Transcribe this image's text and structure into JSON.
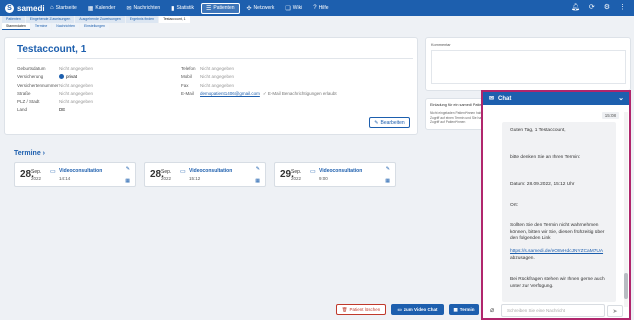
{
  "brand": {
    "name": "samedi"
  },
  "nav": [
    {
      "icon": "⌂",
      "label": "Startseite",
      "active": false
    },
    {
      "icon": "▦",
      "label": "Kalender",
      "active": false
    },
    {
      "icon": "✉",
      "label": "Nachrichten",
      "active": false
    },
    {
      "icon": "▮",
      "label": "Statistik",
      "active": false
    },
    {
      "icon": "☰",
      "label": "Patienten",
      "active": true
    },
    {
      "icon": "✣",
      "label": "Netzwerk",
      "active": false
    },
    {
      "icon": "❑",
      "label": "Wiki",
      "active": false
    },
    {
      "icon": "?",
      "label": "Hilfe",
      "active": false
    }
  ],
  "subtabs": [
    "Patienten",
    "Eingehende Zuweisungen",
    "Ausgehende Zuweisungen",
    "Ergebnis finden",
    "Testaccount, 1"
  ],
  "subtabs2": [
    "Stammdaten",
    "Termine",
    "Nachrichten",
    "Einstellungen"
  ],
  "patient": {
    "name": "Testaccount, 1",
    "fields_left": [
      {
        "key": "Geburtsdatum",
        "value": "Nicht angegeben"
      },
      {
        "key": "Versicherung",
        "value": "privat"
      },
      {
        "key": "Versichertennummer",
        "value": "Nicht angegeben"
      },
      {
        "key": "Straße",
        "value": "Nicht angegeben"
      },
      {
        "key": "PLZ / Stadt",
        "value": "Nicht angegeben"
      },
      {
        "key": "Land",
        "value": "DE"
      }
    ],
    "fields_right": [
      {
        "key": "Telefon",
        "value": "Nicht angegeben"
      },
      {
        "key": "Mobil",
        "value": "Nicht angegeben"
      },
      {
        "key": "Fax",
        "value": "Nicht angegeben"
      },
      {
        "key": "E-Mail",
        "value": "demopatient1406@gmail.com",
        "note": "✓ E-Mail Benachrichtigungen erlaubt"
      }
    ],
    "edit_label": "Bearbeiten"
  },
  "kommentar": {
    "title": "Kommentar"
  },
  "einladung": {
    "title": "Einladung für ein samedi Patientenkonto",
    "desc": "Nicht eingeladen Patient*innen haben Zugriff auf einen Termin und Sie haben Zugriff auf Patient*innen"
  },
  "termine": {
    "title": "Termine",
    "items": [
      {
        "day": "28.",
        "month": "Sep.",
        "year": "2022",
        "type": "Videoconsultation",
        "time": "14:14"
      },
      {
        "day": "28.",
        "month": "Sep.",
        "year": "2022",
        "type": "Videoconsultation",
        "time": "15:12"
      },
      {
        "day": "29.",
        "month": "Sep.",
        "year": "2022",
        "type": "Videoconsultation",
        "time": "9:00"
      }
    ]
  },
  "actions": {
    "delete": "Patient löschen",
    "videochat": "zum Video Chat",
    "termin": "Termin"
  },
  "chat": {
    "title": "Chat",
    "timestamp": "15:08",
    "messages": [
      "Guten Tag, 1 Testaccount,",
      "bitte denken Sie an Ihren Termin:",
      "Datum: 28.09.2022, 15:12 Uhr",
      "Ort:",
      "Sollten Sie den Termin nicht wahrnehmen können, bitten wir Sie, diesen frühzeitig über den folgenden Link",
      "https://s.samedi.de/eO8vHdcJNYZCaM7UA",
      "abzusagen.",
      "Bei Rückfragen stehen wir Ihnen gerne auch unter  zur Verfügung."
    ],
    "input_placeholder": "Schreiben Sie eine Nachricht"
  }
}
